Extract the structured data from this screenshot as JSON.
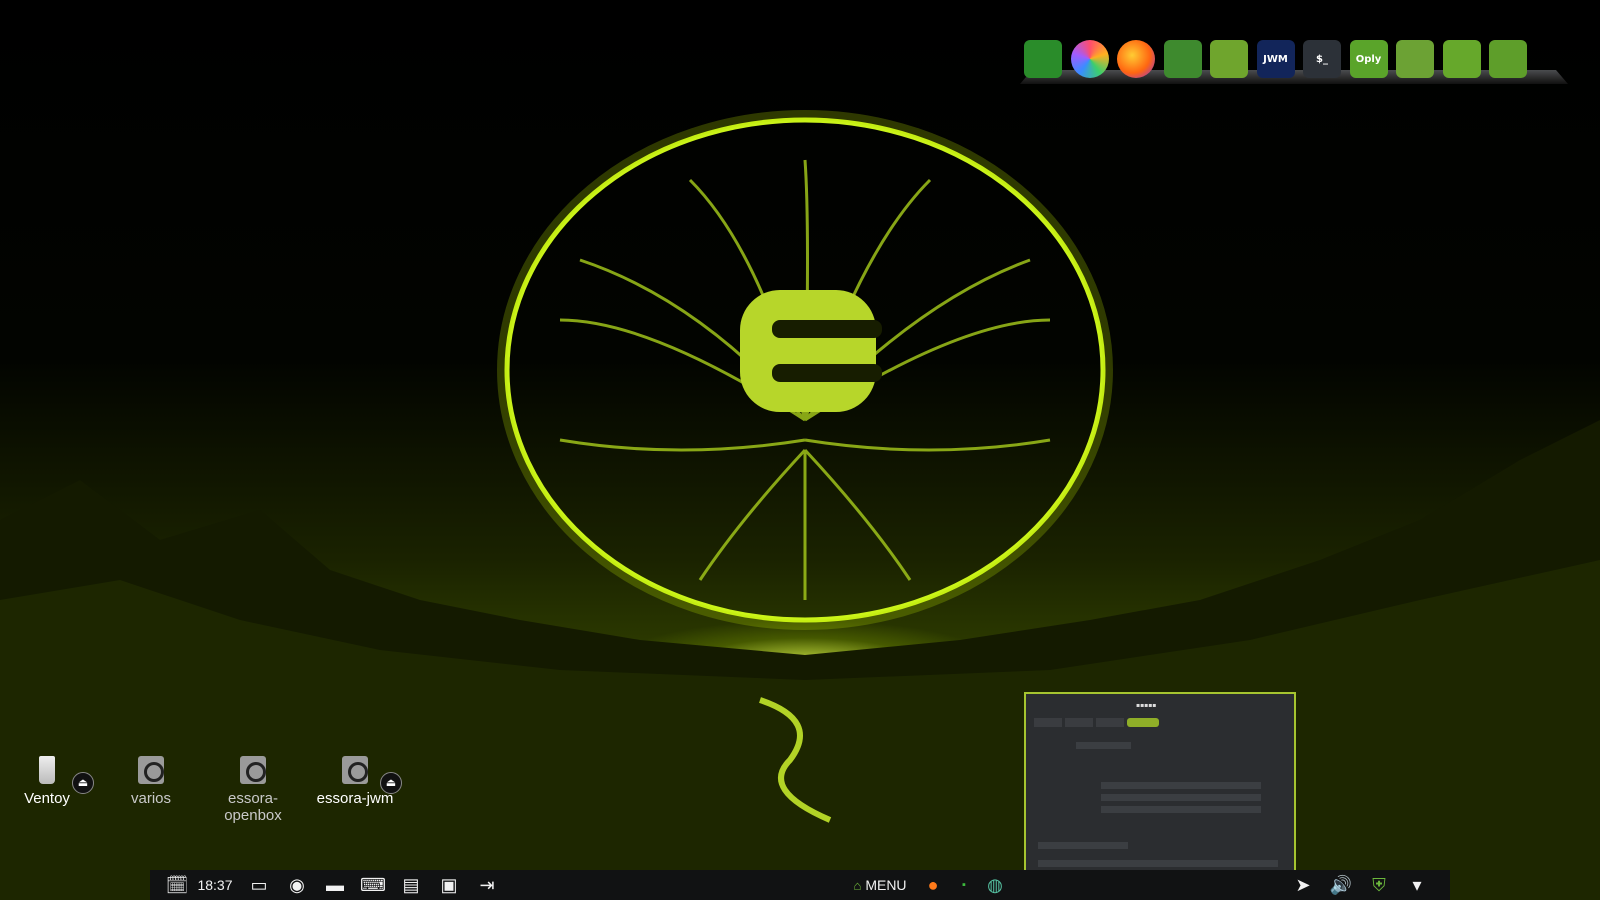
{
  "dock": {
    "icons": [
      {
        "name": "drives-icon",
        "bg": "#2a8c2a",
        "label": ""
      },
      {
        "name": "photos-icon",
        "bg": "#ffffff",
        "label": ""
      },
      {
        "name": "firefox-icon",
        "bg": "#ff6611",
        "label": ""
      },
      {
        "name": "home-folder-icon",
        "bg": "#3e8a2e",
        "label": ""
      },
      {
        "name": "archive-icon",
        "bg": "#6fa52d",
        "label": ""
      },
      {
        "name": "jwm-config-icon",
        "bg": "#12255a",
        "label": "JWM"
      },
      {
        "name": "terminal-icon",
        "bg": "#2c3138",
        "label": "$_"
      },
      {
        "name": "oply-icon",
        "bg": "#5aa42a",
        "label": "Oply"
      },
      {
        "name": "oply-radio-icon",
        "bg": "#6ca234",
        "label": ""
      },
      {
        "name": "oply-screencast-icon",
        "bg": "#66a82b",
        "label": ""
      },
      {
        "name": "oply-video-icon",
        "bg": "#5e9e2a",
        "label": ""
      }
    ]
  },
  "desktop": {
    "items": [
      {
        "label": "Ventoy",
        "kind": "usb",
        "eject": true
      },
      {
        "label": "varios",
        "kind": "hd",
        "eject": false
      },
      {
        "label": "essora-\nopenbox",
        "kind": "hd",
        "eject": false
      },
      {
        "label": "essora-jwm",
        "kind": "hd",
        "eject": true
      }
    ]
  },
  "taskbar": {
    "clock": "18:37",
    "menu_label": "MENU",
    "left_icons": [
      "calendar-clock-icon",
      "show-desktop-icon",
      "firefox-icon",
      "file-manager-icon",
      "terminal-icon",
      "text-editor-icon",
      "package-icon",
      "logout-icon"
    ],
    "right_icons": [
      "telegram-icon",
      "volume-icon",
      "shield-icon",
      "wifi-icon"
    ]
  },
  "wallpaper": {
    "logo_letter": "E",
    "accent": "#c8f000"
  }
}
